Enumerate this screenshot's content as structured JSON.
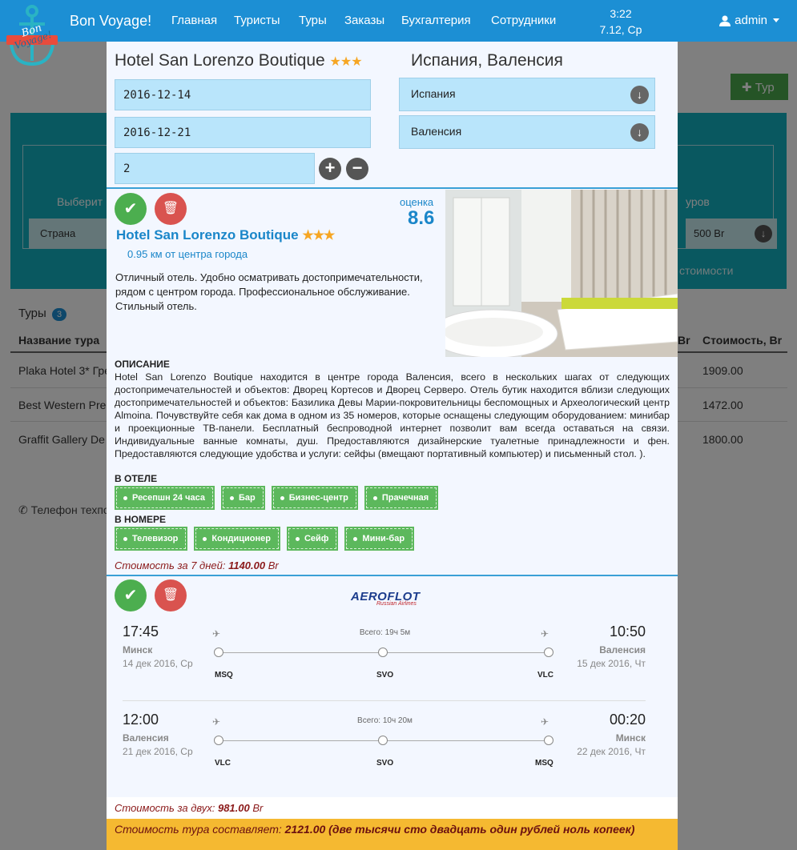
{
  "navbar": {
    "brand": "Bon Voyage!",
    "items": [
      "Главная",
      "Туристы",
      "Туры",
      "Заказы",
      "Бухгалтерия",
      "Сотрудники"
    ],
    "time": "3:22",
    "date": "7.12, Ср",
    "user": "admin",
    "logo_text": "Bon Voyage!"
  },
  "background": {
    "add_tour_label": "Тур",
    "filter_label_left": "Выберит",
    "filter_label_right": "уров",
    "country_placeholder": "Страна",
    "price_value": "500 Br",
    "cost_label": "стоимости",
    "tours_title": "Туры",
    "tours_count": "3",
    "col_name": "Название тура",
    "col_cut": "Br",
    "col_cost": "Стоимость, Br",
    "rows": [
      {
        "name": "Plaka Hotel 3* Гре",
        "cost": "1909.00"
      },
      {
        "name": "Best Western Pre",
        "cost": "1472.00"
      },
      {
        "name": "Graffit Gallery De",
        "cost": "1800.00"
      }
    ],
    "phone_text": "Телефон техпо"
  },
  "modal": {
    "hotel_title": "Hotel San Lorenzo Boutique",
    "stars": "★★★",
    "location_title": "Испания, Валенсия",
    "date_from": "2016-12-14",
    "date_to": "2016-12-21",
    "persons": "2",
    "country": "Испания",
    "city": "Валенсия"
  },
  "hotel_card": {
    "name": "Hotel San Lorenzo Boutique",
    "stars": "★★★",
    "distance": "0.95 км от центра города",
    "rating_label": "оценка",
    "rating": "8.6",
    "summary": "Отличный отель. Удобно осматривать достопримечательности, рядом с центром города. Профессиональное обслуживание. Стильный отель.",
    "description_heading": "ОПИСАНИЕ",
    "description": "Hotel San Lorenzo Boutique находится в центре города Валенсия, всего в нескольких шагах от следующих достопримечательностей и объектов: Дворец Кортесов и Дворец Серверо. Отель бутик находится вблизи следующих достопримечательностей и объектов: Базилика Девы Марии-покровительницы беспомощных и Археологический центр Almoina. Почувствуйте себя как дома в одном из 35 номеров, которые оснащены следующим оборудованием: минибар и проекционные ТВ-панели. Бесплатный беспроводной интернет позволит вам всегда оставаться на связи. Индивидуальные ванные комнаты, душ. Предоставляются дизайнерские туалетные принадлежности и фен. Предоставляются следующие удобства и услуги: сейфы (вмещают портативный компьютер) и письменный стол. ).",
    "in_hotel_heading": "В ОТЕЛЕ",
    "in_hotel": [
      "Ресепшн 24 часа",
      "Бар",
      "Бизнес-центр",
      "Прачечная"
    ],
    "in_room_heading": "В НОМЕРЕ",
    "in_room": [
      "Телевизор",
      "Кондиционер",
      "Сейф",
      "Мини-бар"
    ],
    "cost_label": "Стоимость за 7 дней:",
    "cost_value": "1140.00",
    "cost_unit": "Br"
  },
  "flight_card": {
    "airline": "AEROFLOT",
    "airline_sub": "Russian Airlines",
    "legs": [
      {
        "dep_time": "17:45",
        "dep_city": "Минск",
        "dep_date": "14 дек 2016, Ср",
        "arr_time": "10:50",
        "arr_city": "Валенсия",
        "arr_date": "15 дек 2016, Чт",
        "total": "Всего: 19ч 5м",
        "codes": [
          "MSQ",
          "SVO",
          "VLC"
        ]
      },
      {
        "dep_time": "12:00",
        "dep_city": "Валенсия",
        "dep_date": "21 дек 2016, Ср",
        "arr_time": "00:20",
        "arr_city": "Минск",
        "arr_date": "22 дек 2016, Чт",
        "total": "Всего: 10ч 20м",
        "codes": [
          "VLC",
          "SVO",
          "MSQ"
        ]
      }
    ],
    "cost_label": "Стоимость за двух:",
    "cost_value": "981.00",
    "cost_unit": "Br"
  },
  "total": {
    "label": "Стоимость тура составляет:",
    "value": "2121.00 (две тысячи сто двадцать один рублей ноль копеек)"
  },
  "colors": {
    "navbar": "#1c8fd4",
    "accent_blue": "#1a86c9",
    "success": "#4cae4f",
    "danger": "#d9534f",
    "total_bar": "#f5b931",
    "teal": "#13b0c0"
  }
}
